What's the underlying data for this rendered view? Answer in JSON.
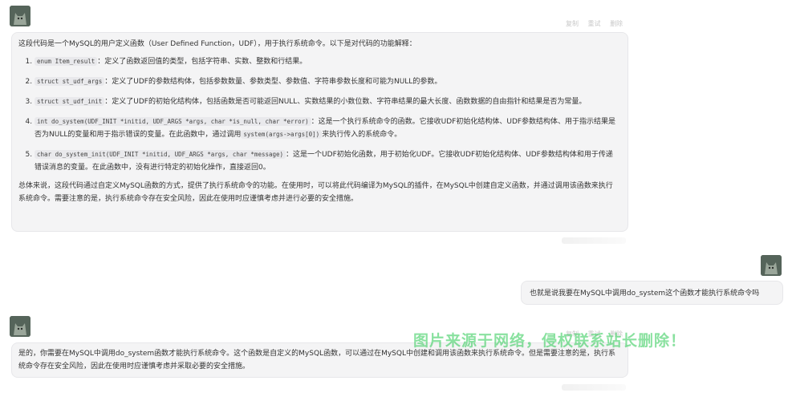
{
  "assistant_actions": {
    "copy": "复制",
    "retry": "重试",
    "delete": "删除"
  },
  "message1": {
    "intro": "这段代码是一个MySQL的用户定义函数（User Defined Function，UDF），用于执行系统命令。以下是对代码的功能解释：",
    "items": [
      {
        "code": "enum Item_result",
        "text": "：定义了函数返回值的类型，包括字符串、实数、整数和行结果。"
      },
      {
        "code": "struct st_udf_args",
        "text": "：定义了UDF的参数结构体，包括参数数量、参数类型、参数值、字符串参数长度和可能为NULL的参数。"
      },
      {
        "code": "struct st_udf_init",
        "text": "：定义了UDF的初始化结构体，包括函数是否可能返回NULL、实数结果的小数位数、字符串结果的最大长度、函数数据的自由指针和结果是否为常量。"
      },
      {
        "code": "int do_system(UDF_INIT *initid, UDF_ARGS *args, char *is_null, char *error)",
        "text": "：这是一个执行系统命令的函数。它接收UDF初始化结构体、UDF参数结构体、用于指示结果是否为NULL的变量和用于指示错误的变量。在此函数中，通过调用",
        "code2": "system(args->args[0])",
        "text2": "来执行传入的系统命令。"
      },
      {
        "code": "char do_system_init(UDF_INIT *initid, UDF_ARGS *args, char *message)",
        "text": "：这是一个UDF初始化函数，用于初始化UDF。它接收UDF初始化结构体、UDF参数结构体和用于传递错误消息的变量。在此函数中，没有进行特定的初始化操作，直接返回0。"
      }
    ],
    "summary": "总体来说，这段代码通过自定义MySQL函数的方式，提供了执行系统命令的功能。在使用时，可以将此代码编译为MySQL的插件，在MySQL中创建自定义函数，并通过调用该函数来执行系统命令。需要注意的是，执行系统命令存在安全风险，因此在使用时应谨慎考虑并进行必要的安全措施。"
  },
  "user_message": {
    "text": "也就是说我要在MySQL中调用do_system这个函数才能执行系统命令吗"
  },
  "message2": {
    "text": "是的，你需要在MySQL中调用do_system函数才能执行系统命令。这个函数是自定义的MySQL函数，可以通过在MySQL中创建和调用该函数来执行系统命令。但是需要注意的是，执行系统命令存在安全风险，因此在使用时应谨慎考虑并采取必要的安全措施。"
  },
  "watermark": "图片来源于网络，侵权联系站长删除！"
}
